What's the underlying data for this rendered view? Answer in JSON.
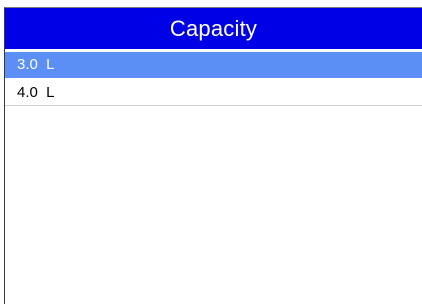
{
  "screen": {
    "title": "Capacity"
  },
  "list": {
    "items": [
      {
        "label": "3.0  L",
        "selected": true
      },
      {
        "label": "4.0  L",
        "selected": false
      }
    ]
  },
  "colors": {
    "title_bar": "#0000e6",
    "selected_row": "#5c8ff5",
    "background": "#ffffff"
  }
}
